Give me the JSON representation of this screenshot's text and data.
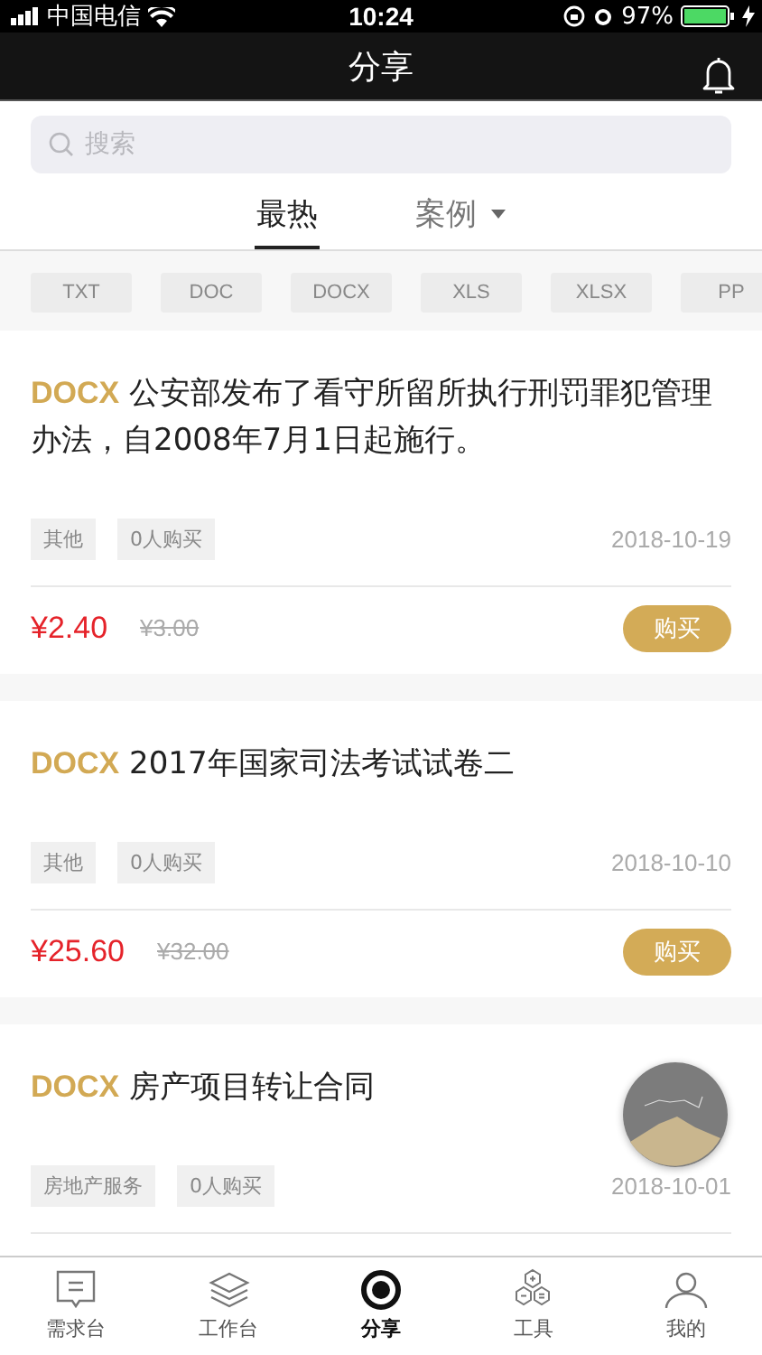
{
  "status_bar": {
    "carrier": "中国电信",
    "time": "10:24",
    "battery": "97%"
  },
  "header": {
    "title": "分享"
  },
  "search": {
    "placeholder": "搜索"
  },
  "tabs": [
    {
      "label": "最热",
      "selected": true,
      "dropdown": false
    },
    {
      "label": "案例",
      "selected": false,
      "dropdown": true
    }
  ],
  "filters": [
    "TXT",
    "DOC",
    "DOCX",
    "XLS",
    "XLSX",
    "PP"
  ],
  "items": [
    {
      "format": "DOCX",
      "title": "公安部发布了看守所留所执行刑罚罪犯管理办法，自2008年7月1日起施行。",
      "tags": [
        "其他",
        "0人购买"
      ],
      "date": "2018-10-19",
      "price": "¥2.40",
      "original_price": "¥3.00",
      "button": "购买"
    },
    {
      "format": "DOCX",
      "title": "2017年国家司法考试试卷二",
      "tags": [
        "其他",
        "0人购买"
      ],
      "date": "2018-10-10",
      "price": "¥25.60",
      "original_price": "¥32.00",
      "button": "购买"
    },
    {
      "format": "DOCX",
      "title": "房产项目转让合同",
      "tags": [
        "房地产服务",
        "0人购买"
      ],
      "date": "2018-10-01"
    }
  ],
  "nav": [
    {
      "label": "需求台",
      "selected": false
    },
    {
      "label": "工作台",
      "selected": false
    },
    {
      "label": "分享",
      "selected": true
    },
    {
      "label": "工具",
      "selected": false
    },
    {
      "label": "我的",
      "selected": false
    }
  ]
}
